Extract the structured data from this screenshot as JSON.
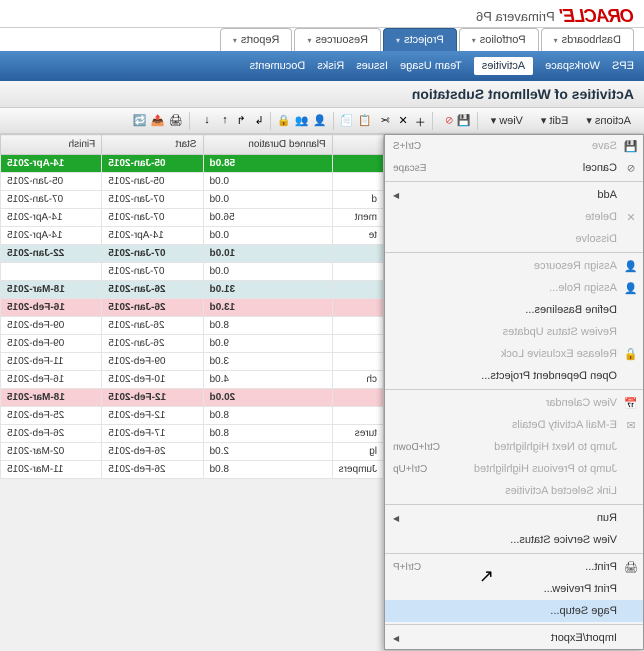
{
  "brand": {
    "logo": "ORACLE'",
    "product": "Primavera P6"
  },
  "tabs": [
    {
      "label": "Dashboards"
    },
    {
      "label": "Portfolios"
    },
    {
      "label": "Projects",
      "active": true
    },
    {
      "label": "Resources"
    },
    {
      "label": "Reports"
    }
  ],
  "subnav": [
    {
      "label": "EPS"
    },
    {
      "label": "Workspace"
    },
    {
      "label": "Activities",
      "active": true
    },
    {
      "label": "Team Usage"
    },
    {
      "label": "Issues"
    },
    {
      "label": "Risks"
    },
    {
      "label": "Documents"
    }
  ],
  "page_title": "Activities of Wellmont Substation",
  "toolbar": {
    "actions": "Actions",
    "edit": "Edit",
    "view": "View"
  },
  "menu": [
    {
      "label": "Save",
      "accel": "Ctrl+S",
      "disabled": true,
      "icon": "💾"
    },
    {
      "label": "Cancel",
      "accel": "Escape",
      "icon": "⦸"
    },
    {
      "sep": true
    },
    {
      "label": "Add",
      "arrow": true,
      "icon": ""
    },
    {
      "label": "Delete",
      "disabled": true,
      "icon": "✕"
    },
    {
      "label": "Dissolve",
      "disabled": true,
      "icon": ""
    },
    {
      "sep": true
    },
    {
      "label": "Assign Resource",
      "disabled": true,
      "icon": "👤"
    },
    {
      "label": "Assign Role...",
      "disabled": true,
      "icon": "👤"
    },
    {
      "label": "Define Baselines...",
      "icon": ""
    },
    {
      "label": "Review Status Updates",
      "disabled": true,
      "icon": ""
    },
    {
      "label": "Release Exclusive Lock",
      "disabled": true,
      "icon": "🔓"
    },
    {
      "label": "Open Dependent Projects...",
      "icon": ""
    },
    {
      "sep": true
    },
    {
      "label": "View Calendar",
      "disabled": true,
      "icon": "📅"
    },
    {
      "label": "E-Mail Activity Details",
      "disabled": true,
      "icon": "✉"
    },
    {
      "label": "Jump to Next Highlighted",
      "accel": "Ctrl+Down",
      "disabled": true,
      "icon": ""
    },
    {
      "label": "Jump to Previous Highlighted",
      "accel": "Ctrl+Up",
      "disabled": true,
      "icon": ""
    },
    {
      "label": "Link Selected Activities",
      "disabled": true,
      "icon": ""
    },
    {
      "sep": true
    },
    {
      "label": "Run",
      "arrow": true,
      "icon": ""
    },
    {
      "label": "View Service Status...",
      "icon": ""
    },
    {
      "sep": true
    },
    {
      "label": "Print...",
      "accel": "Ctrl+P",
      "icon": "🖨"
    },
    {
      "label": "Print Preview...",
      "icon": ""
    },
    {
      "label": "Page Setup...",
      "hover": true,
      "icon": ""
    },
    {
      "sep": true
    },
    {
      "label": "Import/Export",
      "arrow": true,
      "icon": ""
    }
  ],
  "grid": {
    "col_name": "",
    "col_dur": "Planned Duration",
    "col_start": "Start",
    "col_finish": "Finish",
    "rows": [
      {
        "cls": "green",
        "name": "",
        "dur": "58.0d",
        "start": "05-Jan-2015",
        "finish": "14-Apr-2015"
      },
      {
        "cls": "white",
        "name": "",
        "dur": "0.0d",
        "start": "05-Jan-2015",
        "finish": "05-Jan-2015"
      },
      {
        "cls": "white",
        "name": "d",
        "dur": "0.0d",
        "start": "07-Jan-2015",
        "finish": "07-Jan-2015"
      },
      {
        "cls": "white",
        "name": "ment",
        "dur": "56.0d",
        "start": "07-Jan-2015",
        "finish": "14-Apr-2015"
      },
      {
        "cls": "white",
        "name": "te",
        "dur": "0.0d",
        "start": "14-Apr-2015",
        "finish": "14-Apr-2015"
      },
      {
        "cls": "blue",
        "name": "",
        "dur": "10.0d",
        "start": "07-Jan-2015",
        "finish": "22-Jan-2015"
      },
      {
        "cls": "white",
        "name": "",
        "dur": "0.0d",
        "start": "07-Jan-2015",
        "finish": ""
      },
      {
        "cls": "blue",
        "name": "",
        "dur": "31.0d",
        "start": "26-Jan-2015",
        "finish": "18-Mar-2015"
      },
      {
        "cls": "pink",
        "name": "",
        "dur": "13.0d",
        "start": "26-Jan-2015",
        "finish": "16-Feb-2015"
      },
      {
        "cls": "white",
        "name": "",
        "dur": "8.0d",
        "start": "26-Jan-2015",
        "finish": "09-Feb-2015"
      },
      {
        "cls": "white",
        "name": "",
        "dur": "9.0d",
        "start": "26-Jan-2015",
        "finish": "09-Feb-2015"
      },
      {
        "cls": "white",
        "name": "",
        "dur": "3.0d",
        "start": "09-Feb-2015",
        "finish": "11-Feb-2015"
      },
      {
        "cls": "white",
        "name": "ch",
        "dur": "4.0d",
        "start": "10-Feb-2015",
        "finish": "16-Feb-2015"
      },
      {
        "cls": "pink",
        "name": "",
        "dur": "20.0d",
        "start": "12-Feb-2015",
        "finish": "18-Mar-2015"
      },
      {
        "cls": "white",
        "name": "",
        "dur": "8.0d",
        "start": "12-Feb-2015",
        "finish": "25-Feb-2015"
      },
      {
        "cls": "white",
        "name": "tures",
        "dur": "8.0d",
        "start": "17-Feb-2015",
        "finish": "26-Feb-2015"
      },
      {
        "cls": "white",
        "name": "lg",
        "dur": "2.0d",
        "start": "26-Feb-2015",
        "finish": "02-Mar-2015"
      },
      {
        "cls": "white",
        "name": "Jumpers",
        "dur": "8.0d",
        "start": "26-Feb-2015",
        "finish": "11-Mar-2015"
      }
    ]
  }
}
